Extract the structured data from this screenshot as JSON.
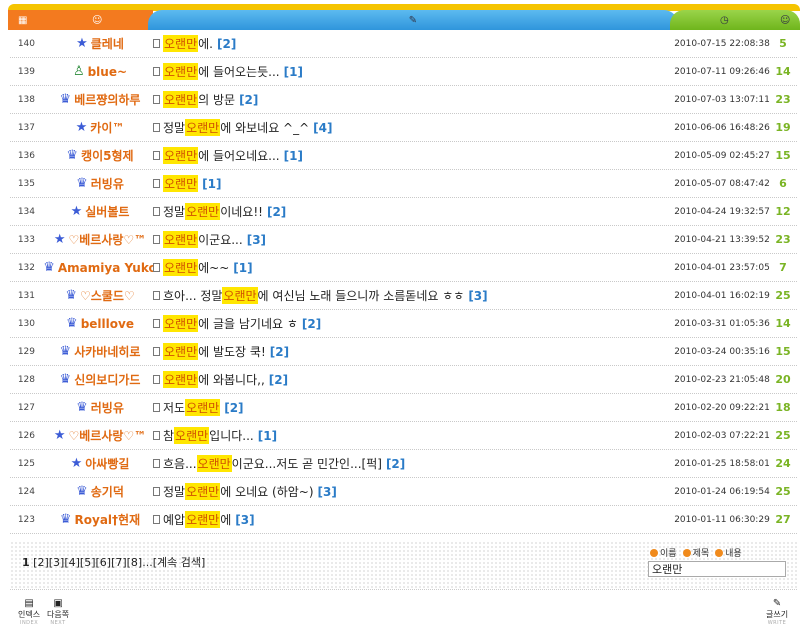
{
  "header": {
    "col_icons": [
      "grid-icon",
      "user-icon",
      "pencil-icon",
      "clock-icon",
      "smile-icon"
    ],
    "colors": {
      "orange": "#f37a1f",
      "blue": "#3a9fe2",
      "green": "#7dbd26",
      "yellow": "#f5c400"
    }
  },
  "rows": [
    {
      "num": "140",
      "icon": "star-icon",
      "name": "클레네",
      "pre": "",
      "hl": "오랜만",
      "post": "에.",
      "cmt": "[2]",
      "date": "2010-07-15 22:08:38",
      "views": "5"
    },
    {
      "num": "139",
      "icon": "user-icon",
      "name": "blue~",
      "pre": "",
      "hl": "오랜만",
      "post": "에 들어오는듯...",
      "cmt": "[1]",
      "date": "2010-07-11 09:26:46",
      "views": "14"
    },
    {
      "num": "138",
      "icon": "shield-icon",
      "name": "베르쨩의하루",
      "pre": "",
      "hl": "오랜만",
      "post": "의 방문",
      "cmt": "[2]",
      "date": "2010-07-03 13:07:11",
      "views": "23"
    },
    {
      "num": "137",
      "icon": "star-icon",
      "name": "카이™",
      "pre": "정말 ",
      "hl": "오랜만",
      "post": "에 와보네요 ^_^",
      "cmt": "[4]",
      "date": "2010-06-06 16:48:26",
      "views": "19"
    },
    {
      "num": "136",
      "icon": "shield-icon",
      "name": "캥이5형제",
      "pre": "",
      "hl": "오랜만",
      "post": "에 들어오네요...",
      "cmt": "[1]",
      "date": "2010-05-09 02:45:27",
      "views": "15"
    },
    {
      "num": "135",
      "icon": "shield-icon",
      "name": "러빙유",
      "pre": "",
      "hl": "오랜만",
      "post": "",
      "cmt": "[1]",
      "date": "2010-05-07 08:47:42",
      "views": "6"
    },
    {
      "num": "134",
      "icon": "star-icon",
      "name": "실버볼트",
      "pre": "정말 ",
      "hl": "오랜만",
      "post": "이네요!!",
      "cmt": "[2]",
      "date": "2010-04-24 19:32:57",
      "views": "12"
    },
    {
      "num": "133",
      "icon": "star-icon",
      "name": "♡베르사랑♡™",
      "pre": "",
      "hl": "오랜만",
      "post": "이군요...",
      "cmt": "[3]",
      "date": "2010-04-21 13:39:52",
      "views": "23"
    },
    {
      "num": "132",
      "icon": "shield-icon",
      "name": "Amamiya Yuko",
      "pre": "",
      "hl": "오랜만",
      "post": "에~~",
      "cmt": "[1]",
      "date": "2010-04-01 23:57:05",
      "views": "7"
    },
    {
      "num": "131",
      "icon": "shield-icon",
      "name": "♡스쿨드♡",
      "pre": "흐아... 정말 ",
      "hl": "오랜만",
      "post": "에 여신님 노래 들으니까 소름돋네요 ㅎㅎ",
      "cmt": "[3]",
      "date": "2010-04-01 16:02:19",
      "views": "25"
    },
    {
      "num": "130",
      "icon": "shield-icon",
      "name": "belllove",
      "pre": "",
      "hl": "오랜만",
      "post": "에 글을 남기네요 ㅎ",
      "cmt": "[2]",
      "date": "2010-03-31 01:05:36",
      "views": "14"
    },
    {
      "num": "129",
      "icon": "shield-icon",
      "name": "사카바네히로",
      "pre": "",
      "hl": "오랜만",
      "post": "에 발도장 쿡!",
      "cmt": "[2]",
      "date": "2010-03-24 00:35:16",
      "views": "15"
    },
    {
      "num": "128",
      "icon": "shield-icon",
      "name": "신의보디가드",
      "pre": "",
      "hl": "오랜만",
      "post": "에 와봅니다,,",
      "cmt": "[2]",
      "date": "2010-02-23 21:05:48",
      "views": "20"
    },
    {
      "num": "127",
      "icon": "shield-icon",
      "name": "러빙유",
      "pre": "저도 ",
      "hl": "오랜만",
      "post": "",
      "cmt": "[2]",
      "date": "2010-02-20 09:22:21",
      "views": "18"
    },
    {
      "num": "126",
      "icon": "star-icon",
      "name": "♡베르사랑♡™",
      "pre": "참 ",
      "hl": "오랜만",
      "post": "입니다...",
      "cmt": "[1]",
      "date": "2010-02-03 07:22:21",
      "views": "25"
    },
    {
      "num": "125",
      "icon": "star-icon",
      "name": "아싸빵길",
      "pre": "흐음...",
      "hl": "오랜만",
      "post": "이군요...저도 곧 민간인...[퍽]",
      "cmt": "[2]",
      "date": "2010-01-25 18:58:01",
      "views": "24"
    },
    {
      "num": "124",
      "icon": "shield-icon",
      "name": "송기덕",
      "pre": "정말 ",
      "hl": "오랜만",
      "post": "에 오네요 (하암~)",
      "cmt": "[3]",
      "date": "2010-01-24 06:19:54",
      "views": "25"
    },
    {
      "num": "123",
      "icon": "shield-icon",
      "name": "Royal†현재",
      "pre": "예압 ",
      "hl": "오랜만",
      "post": "에",
      "cmt": "[3]",
      "date": "2010-01-11 06:30:29",
      "views": "27"
    }
  ],
  "pager": {
    "current": "1",
    "pages": "[2][3][4][5][6][7][8]...",
    "continue": "[계속 검색]"
  },
  "search": {
    "opt_name": "이름",
    "opt_subject": "제목",
    "opt_content": "내용",
    "value": "오랜만"
  },
  "nav": {
    "index": "인덱스",
    "index_sub": "INDEX",
    "next": "다음쪽",
    "next_sub": "NEXT",
    "write": "글쓰기",
    "write_sub": "WRITE"
  }
}
